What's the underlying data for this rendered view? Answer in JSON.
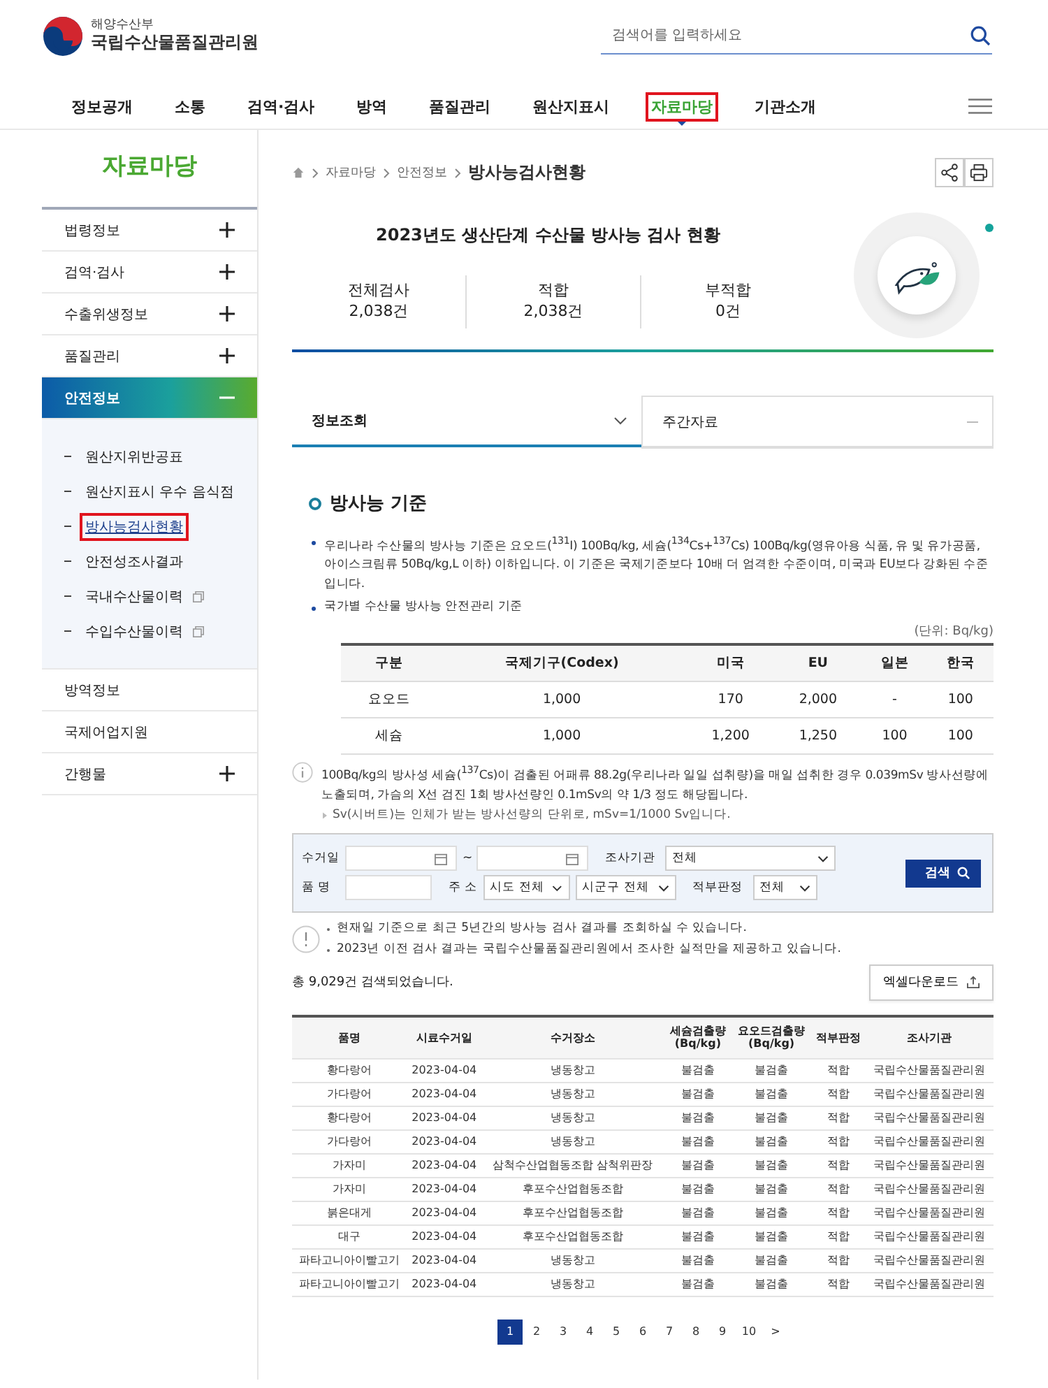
{
  "header": {
    "ministry": "해양수산부",
    "org_name": "국립수산물품질관리원",
    "search": {
      "placeholder": "검색어를 입력하세요"
    }
  },
  "nav": [
    {
      "label": "정보공개",
      "selected": false
    },
    {
      "label": "소통",
      "selected": false
    },
    {
      "label": "검역·검사",
      "selected": false
    },
    {
      "label": "방역",
      "selected": false
    },
    {
      "label": "품질관리",
      "selected": false
    },
    {
      "label": "원산지표시",
      "selected": false
    },
    {
      "label": "자료마당",
      "selected": true
    },
    {
      "label": "기관소개",
      "selected": false
    }
  ],
  "sidebar": {
    "title": "자료마당",
    "items": [
      {
        "label": "법령정보",
        "kind": "expandable",
        "expanded": false,
        "selected": false
      },
      {
        "label": "검역·검사",
        "kind": "expandable",
        "expanded": false,
        "selected": false
      },
      {
        "label": "수출위생정보",
        "kind": "expandable",
        "expanded": false,
        "selected": false
      },
      {
        "label": "품질관리",
        "kind": "expandable",
        "expanded": false,
        "selected": false
      },
      {
        "label": "안전정보",
        "kind": "expandable",
        "expanded": true,
        "selected": true,
        "children": [
          {
            "label": "원산지위반공표",
            "selected": false,
            "external": false
          },
          {
            "label": "원산지표시 우수 음식점",
            "selected": false,
            "external": false
          },
          {
            "label": "방사능검사현황",
            "selected": true,
            "external": false
          },
          {
            "label": "안전성조사결과",
            "selected": false,
            "external": false
          },
          {
            "label": "국내수산물이력",
            "selected": false,
            "external": true
          },
          {
            "label": "수입수산물이력",
            "selected": false,
            "external": true
          }
        ]
      },
      {
        "label": "방역정보",
        "kind": "plain",
        "selected": false
      },
      {
        "label": "국제어업지원",
        "kind": "plain",
        "selected": false
      },
      {
        "label": "간행물",
        "kind": "expandable",
        "expanded": false,
        "selected": false
      }
    ]
  },
  "breadcrumb": {
    "items": [
      "자료마당",
      "안전정보"
    ],
    "current": "방사능검사현황"
  },
  "summary": {
    "title": "2023년도 생산단계 수산물 방사능 검사 현황",
    "stats": [
      {
        "label": "전체검사",
        "value": "2,038건"
      },
      {
        "label": "적합",
        "value": "2,038건"
      },
      {
        "label": "부적합",
        "value": "0건"
      }
    ]
  },
  "tabs": [
    {
      "label": "정보조회",
      "selected": true
    },
    {
      "label": "주간자료",
      "selected": false
    }
  ],
  "standards": {
    "heading": "방사능 기준",
    "bullets": [
      "우리나라 수산물의 방사능 기준은 요오드($^{131}$I) 100Bq/kg, 세슘($^{134}$Cs+$^{137}$Cs) 100Bq/kg(영유아용 식품, 유 및 유가공품, 아이스크림류 50Bq/kg,L 이하) 이하입니다. 이 기준은 국제기준보다 10배 더 엄격한 수준이며, 미국과 EU보다 강화된 수준입니다.",
      "국가별 수산물 방사능 안전관리 기준"
    ],
    "unit": "(단위: Bq/kg)",
    "columns": [
      "구분",
      "국제기구(Codex)",
      "미국",
      "EU",
      "일본",
      "한국"
    ],
    "rows": [
      [
        "요오드",
        "1,000",
        "170",
        "2,000",
        "-",
        "100"
      ],
      [
        "세슘",
        "1,000",
        "1,200",
        "1,250",
        "100",
        "100"
      ]
    ],
    "info": "100Bq/kg의 방사성 세슘($^{137}$Cs)이 검출된 어패류 88.2g(우리나라 일일 섭취량)을 매일 섭취한 경우 0.039mSv 방사선량에 노출되며, 가슴의 X선 검진 1회 방사선량인 0.1mSv의 약 1/3 정도 해당됩니다.",
    "sub_note": "Sv(시버트)는 인체가 받는 방사선량의 단위로, mSv=1/1000 Sv입니다."
  },
  "search_form": {
    "date_label": "수거일",
    "range_sep": "~",
    "agency_label": "조사기관",
    "agency_value": "전체",
    "name_label": "품 명",
    "address_label": "주 소",
    "province_value": "시도 전체",
    "district_value": "시군구 전체",
    "verdict_label": "적부판정",
    "verdict_value": "전체",
    "button": "검색"
  },
  "notices": [
    "현재일 기준으로 최근 5년간의 방사능 검사 결과를 조회하실 수 있습니다.",
    "2023년 이전 검사 결과는 국립수산물품질관리원에서 조사한 실적만을 제공하고 있습니다."
  ],
  "result_count": "총 9,029건 검색되었습니다.",
  "excel_button": "엑셀다운로드",
  "results": {
    "columns": [
      "품명",
      "시료수거일",
      "수거장소",
      "세슘검출량\n(Bq/kg)",
      "요오드검출량\n(Bq/kg)",
      "적부판정",
      "조사기관"
    ],
    "rows": [
      [
        "황다랑어",
        "2023-04-04",
        "냉동창고",
        "불검출",
        "불검출",
        "적합",
        "국립수산물품질관리원"
      ],
      [
        "가다랑어",
        "2023-04-04",
        "냉동창고",
        "불검출",
        "불검출",
        "적합",
        "국립수산물품질관리원"
      ],
      [
        "황다랑어",
        "2023-04-04",
        "냉동창고",
        "불검출",
        "불검출",
        "적합",
        "국립수산물품질관리원"
      ],
      [
        "가다랑어",
        "2023-04-04",
        "냉동창고",
        "불검출",
        "불검출",
        "적합",
        "국립수산물품질관리원"
      ],
      [
        "가자미",
        "2023-04-04",
        "삼척수산업협동조합 삼척위판장",
        "불검출",
        "불검출",
        "적합",
        "국립수산물품질관리원"
      ],
      [
        "가자미",
        "2023-04-04",
        "후포수산업협동조합",
        "불검출",
        "불검출",
        "적합",
        "국립수산물품질관리원"
      ],
      [
        "붉은대게",
        "2023-04-04",
        "후포수산업협동조합",
        "불검출",
        "불검출",
        "적합",
        "국립수산물품질관리원"
      ],
      [
        "대구",
        "2023-04-04",
        "후포수산업협동조합",
        "불검출",
        "불검출",
        "적합",
        "국립수산물품질관리원"
      ],
      [
        "파타고니아이빨고기",
        "2023-04-04",
        "냉동창고",
        "불검출",
        "불검출",
        "적합",
        "국립수산물품질관리원"
      ],
      [
        "파타고니아이빨고기",
        "2023-04-04",
        "냉동창고",
        "불검출",
        "불검출",
        "적합",
        "국립수산물품질관리원"
      ]
    ]
  },
  "pagination": {
    "pages": [
      {
        "label": "1",
        "selected": true
      },
      {
        "label": "2",
        "selected": false
      },
      {
        "label": "3",
        "selected": false
      },
      {
        "label": "4",
        "selected": false
      },
      {
        "label": "5",
        "selected": false
      },
      {
        "label": "6",
        "selected": false
      },
      {
        "label": "7",
        "selected": false
      },
      {
        "label": "8",
        "selected": false
      },
      {
        "label": "9",
        "selected": false
      },
      {
        "label": "10",
        "selected": false
      }
    ],
    "next": ">"
  }
}
